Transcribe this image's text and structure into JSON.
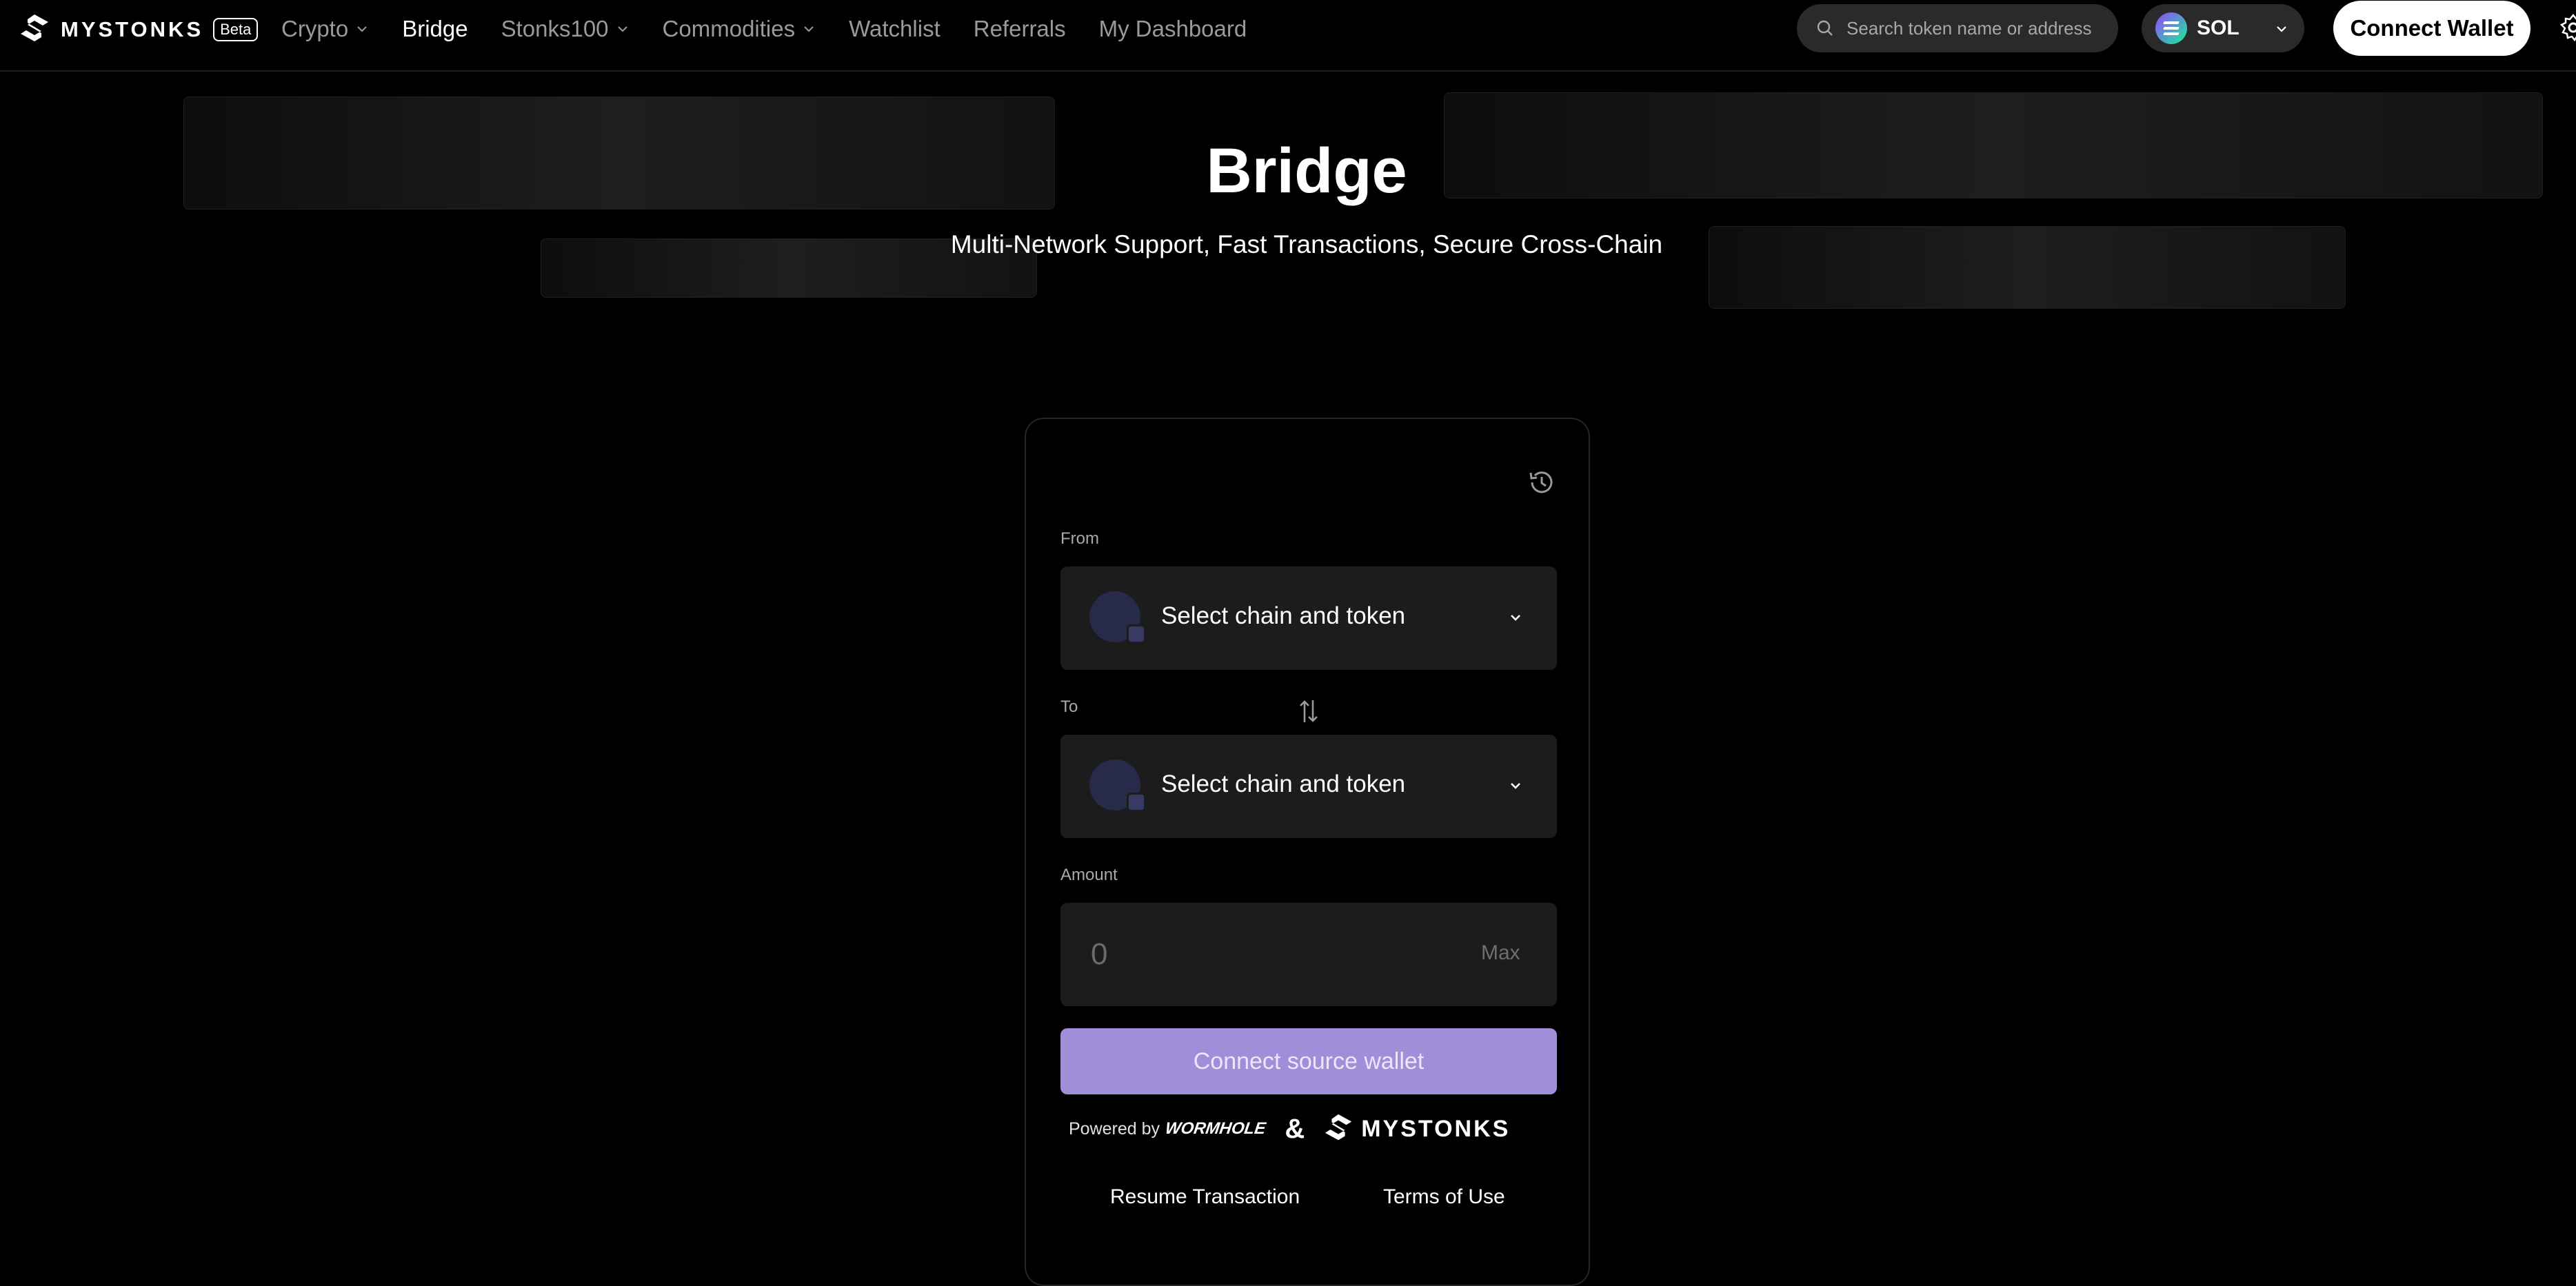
{
  "brand": {
    "name": "MYSTONKS",
    "badge": "Beta"
  },
  "nav": {
    "items": [
      {
        "label": "Crypto",
        "dropdown": true,
        "active": false
      },
      {
        "label": "Bridge",
        "dropdown": false,
        "active": true
      },
      {
        "label": "Stonks100",
        "dropdown": true,
        "active": false
      },
      {
        "label": "Commodities",
        "dropdown": true,
        "active": false
      },
      {
        "label": "Watchlist",
        "dropdown": false,
        "active": false
      },
      {
        "label": "Referrals",
        "dropdown": false,
        "active": false
      },
      {
        "label": "My Dashboard",
        "dropdown": false,
        "active": false
      }
    ]
  },
  "search": {
    "placeholder": "Search token name or address",
    "icon": "search-icon"
  },
  "chain_selector": {
    "label": "SOL",
    "icon": "solana-icon"
  },
  "header_actions": {
    "connect_wallet": "Connect Wallet",
    "settings_icon": "gear-icon"
  },
  "hero": {
    "title": "Bridge",
    "subtitle": "Multi-Network Support, Fast Transactions, Secure Cross-Chain"
  },
  "bridge_card": {
    "history_icon": "history-icon",
    "from": {
      "label": "From",
      "select_text": "Select chain and token"
    },
    "to": {
      "label": "To",
      "select_text": "Select chain and token"
    },
    "swap_icon": "swap-arrows-icon",
    "amount": {
      "label": "Amount",
      "placeholder": "0",
      "max_label": "Max"
    },
    "primary_button": "Connect source wallet",
    "powered_by": {
      "label": "Powered by",
      "partner": "WORMHOLE",
      "ampersand": "&",
      "brand": "MYSTONKS"
    },
    "links": {
      "resume": "Resume Transaction",
      "terms": "Terms of Use"
    }
  },
  "colors": {
    "background": "#000000",
    "surface": "#1c1c1c",
    "accent": "#a08fd8",
    "muted_text": "#9a9a9a"
  }
}
